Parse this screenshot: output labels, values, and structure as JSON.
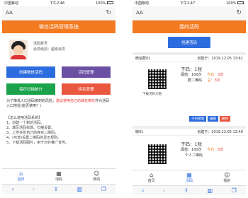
{
  "left": {
    "status": {
      "carrier": "中国移动",
      "time": "下午2:46",
      "battery": "100%"
    },
    "browser": {
      "text_size": "AA",
      "reload_icon": "refresh-icon"
    },
    "header_title": "微信活码管理系统",
    "profile": {
      "account_line": "活码账号",
      "level_line": "会员级别：超级会员"
    },
    "buttons": [
      {
        "label": "创建微信活码",
        "color": "#2d6cdf"
      },
      {
        "label": "活码管理",
        "color": "#6a4fa3"
      },
      {
        "label": "每日扫描统计",
        "color": "#1aa34a"
      },
      {
        "label": "续名管理",
        "color": "#e9573f"
      }
    ],
    "notice": {
      "text_a": "为了降低人口活码被封的风险，",
      "highlight": "建议使用自己的域名绑定",
      "text_b": "作为活码入口地址(能否使用？)"
    },
    "instructions": {
      "title": "【怎么使用活码系统】",
      "steps": [
        "1、创建一个新的活码。",
        "2、填写活码标题、扫描设置。",
        "3、上传多张自己的真实二维码。",
        "4、(可选)设置二维码的显示规则。",
        "5、下载活码图片，用于对外推广宣传。"
      ]
    },
    "tabs": [
      {
        "label": "首页",
        "icon": "home-icon",
        "active": true
      },
      {
        "label": "活码",
        "icon": "qr-icon",
        "active": false
      },
      {
        "label": "我的",
        "icon": "user-icon",
        "active": false
      }
    ]
  },
  "right": {
    "status": {
      "carrier": "中国移动",
      "time": "下午2:47",
      "battery": "100%"
    },
    "browser": {
      "text_size": "AA",
      "reload_icon": "refresh-icon"
    },
    "header_title": "我的活码",
    "create_button": "创建活码",
    "cards": [
      {
        "name": "微信群01",
        "created": "创建于：2019.12.05 13:41",
        "qr_caption": "下载活码大图",
        "sub_label": "子码：",
        "sub_value": "1张",
        "threshold_label": "阈值：",
        "threshold_value": "100次",
        "today_label": "今日：",
        "today_value": "3次",
        "total_label": "总：",
        "total_value": "3次",
        "type_label": "群二维码",
        "actions": [
          {
            "label": "子码管理",
            "color": "#2d6cdf"
          },
          {
            "label": "编辑",
            "color": "#2d6cdf"
          },
          {
            "label": "删除",
            "color": "#e9573f"
          }
        ]
      },
      {
        "name": "微01",
        "created": "创建于：2019.12.05 13:40",
        "qr_caption": "下载活码大图",
        "sub_label": "子码：",
        "sub_value": "1张",
        "threshold_label": "阈值：",
        "threshold_value": "100次",
        "today_label": "今日：",
        "today_value": "0次",
        "total_label": "",
        "total_value": "",
        "type_label": "个人二维码",
        "actions": []
      }
    ],
    "tabs": [
      {
        "label": "首页",
        "icon": "home-icon",
        "active": false
      },
      {
        "label": "活码",
        "icon": "qr-icon",
        "active": true
      },
      {
        "label": "我的",
        "icon": "user-icon",
        "active": false
      }
    ]
  },
  "browser_nav": {
    "back": "‹",
    "forward": "›",
    "share": "share-icon",
    "book": "book-icon",
    "tabs": "tabs-icon"
  }
}
